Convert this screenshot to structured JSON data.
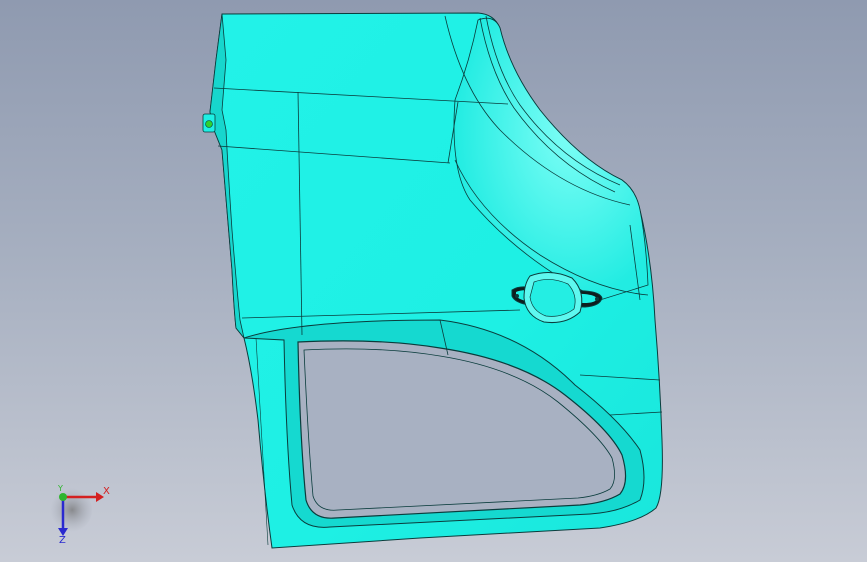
{
  "viewport": {
    "background_top": "#8f9ab0",
    "background_bottom": "#c8ccd6"
  },
  "model": {
    "fill_color": "#1ef2e6",
    "highlight_color": "#6ffcf4",
    "shade_color": "#12cfc8",
    "edge_color": "#0a3c3c",
    "selection_point_color": "#2fd12f"
  },
  "triad": {
    "x_label": "X",
    "y_label": "Y",
    "z_label": "Z",
    "x_color": "#d42020",
    "y_color": "#2fb52f",
    "z_color": "#2a2ad0"
  }
}
